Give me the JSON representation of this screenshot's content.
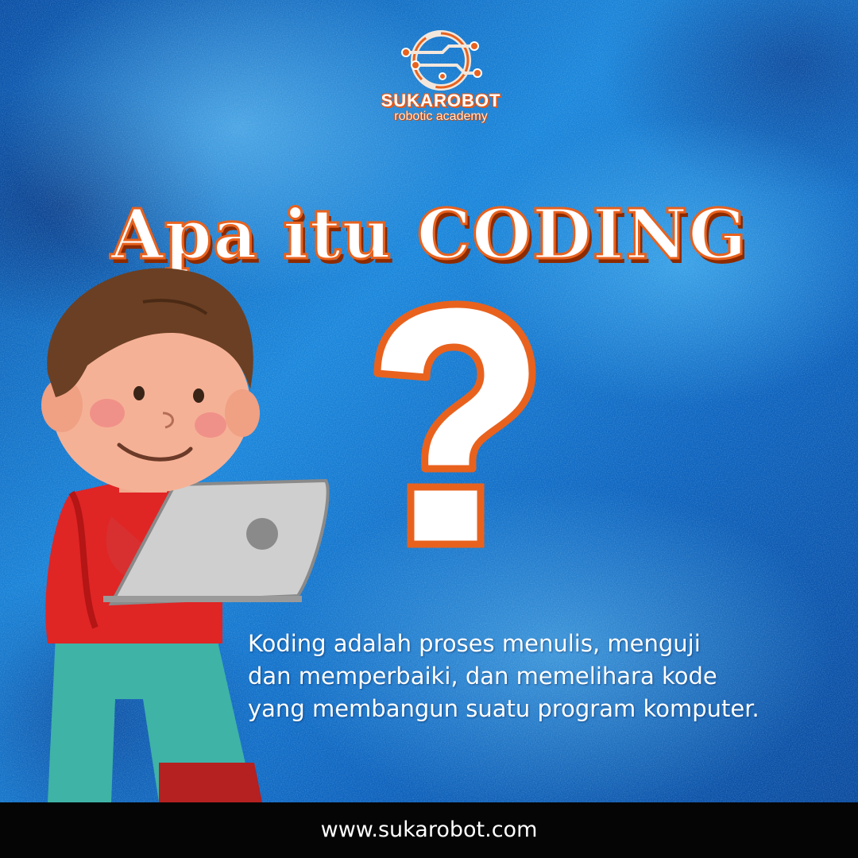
{
  "brand": {
    "name": "SUKAROBOT",
    "tagline": "robotic academy",
    "logo_icon": "circuit-logo-icon"
  },
  "headline": "Apa itu CODING",
  "question_mark": "?",
  "description": {
    "lines": [
      "Koding adalah proses menulis, menguji",
      "dan memperbaiki, dan memelihara kode",
      "yang membangun suatu program komputer."
    ]
  },
  "footer": {
    "url": "www.sukarobot.com"
  },
  "colors": {
    "accent_orange": "#e8621e",
    "background_blue": "#1a86db",
    "footer_bg": "#050505",
    "text_white": "#ffffff"
  }
}
